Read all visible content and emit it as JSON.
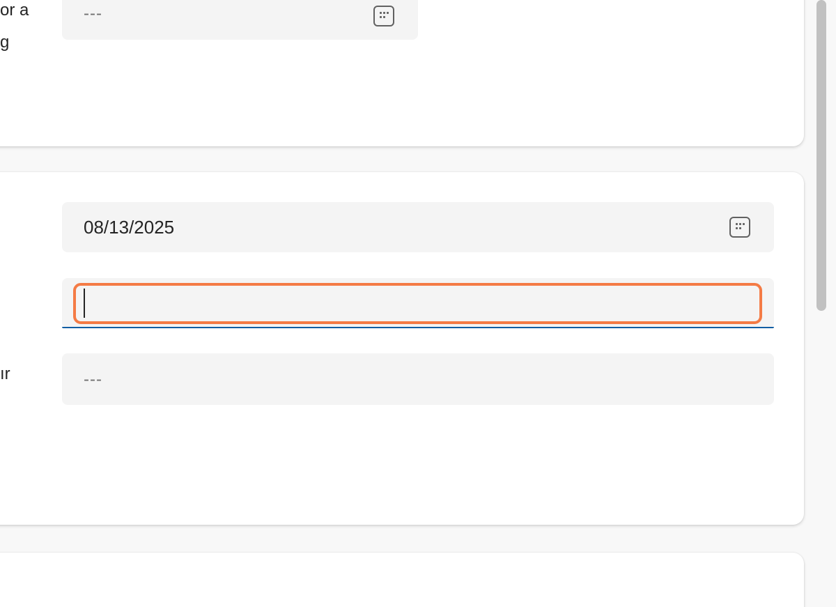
{
  "section1": {
    "label_line1": "or a",
    "label_line2": "g",
    "field_placeholder": "---",
    "calendar_icon": "calendar-icon"
  },
  "section2": {
    "date_value": "08/13/2025",
    "calendar_icon": "calendar-icon",
    "active_field_value": "",
    "label_fragment": "ır",
    "text_field_placeholder": "---"
  },
  "colors": {
    "page_background": "#f8f8f8",
    "card_background": "#ffffff",
    "field_background": "#f4f4f4",
    "focus_underline": "#115ea3",
    "highlight_ring": "#f47b45",
    "text": "#242424",
    "placeholder": "#707070"
  }
}
